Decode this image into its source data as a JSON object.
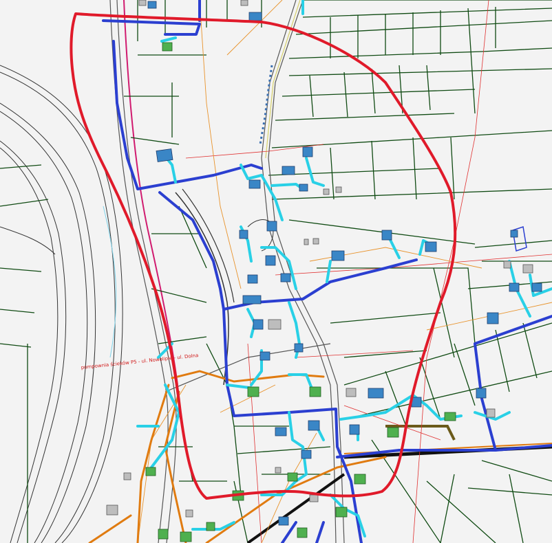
{
  "map": {
    "label_text": "pompownia ścieków P5 - ul. Nowolipie - ul. Dolna",
    "colors": {
      "boundary": "#e01a2a",
      "sewer_gravity": "#2b3fd0",
      "sewer_connection": "#29d0e6",
      "pressure_pipe": "#e07b10",
      "parcel_lines": "#0f4a12",
      "building_planned": "#3a86c6",
      "building_existing": "#4fb04f"
    }
  }
}
